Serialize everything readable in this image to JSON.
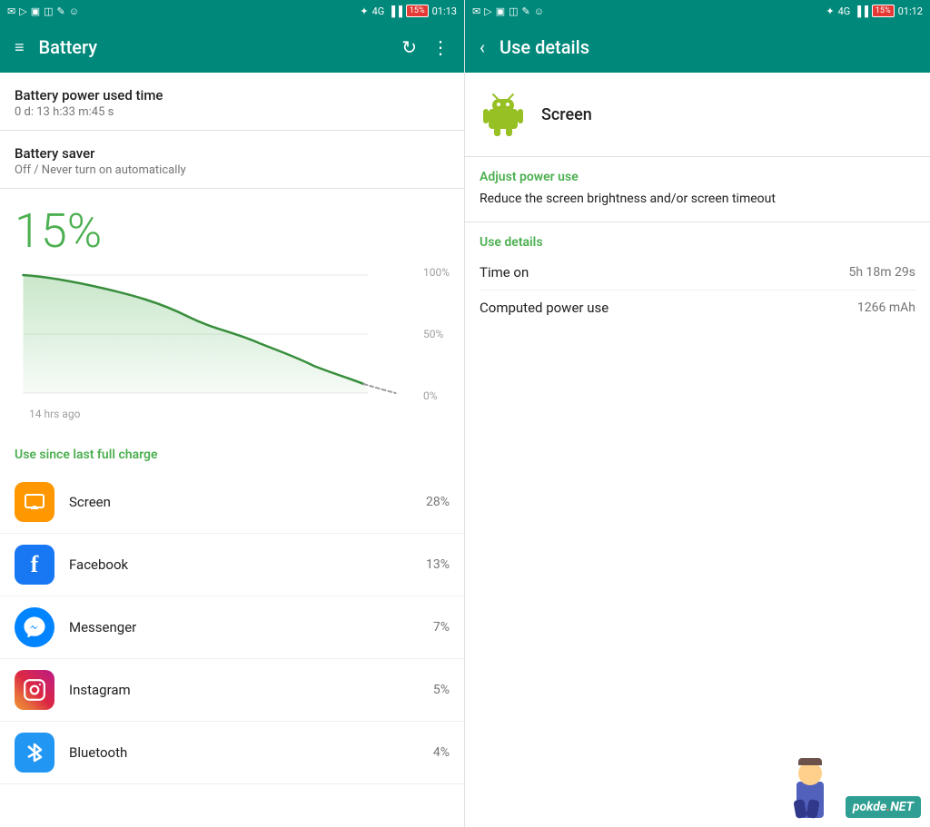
{
  "left": {
    "statusBar": {
      "icons_left": [
        "message",
        "location",
        "camera",
        "wifi",
        "pencil",
        "chat"
      ],
      "bluetooth": "⬡",
      "signal": "4G",
      "battery_label": "15%",
      "time": "01:13"
    },
    "toolbar": {
      "menu_label": "≡",
      "title": "Battery",
      "refresh_label": "↻",
      "more_label": "⋮"
    },
    "battery_power_used": {
      "label": "Battery power used time",
      "value": "0 d: 13 h:33 m:45 s"
    },
    "battery_saver": {
      "label": "Battery saver",
      "value": "Off / Never turn on automatically"
    },
    "percentage": "15%",
    "chart": {
      "time_ago": "14 hrs ago",
      "labels": [
        "100%",
        "50%",
        "0%"
      ]
    },
    "section_title": "Use since last full charge",
    "apps": [
      {
        "name": "Screen",
        "percent": "28%",
        "icon_type": "screen"
      },
      {
        "name": "Facebook",
        "percent": "13%",
        "icon_type": "facebook"
      },
      {
        "name": "Messenger",
        "percent": "7%",
        "icon_type": "messenger"
      },
      {
        "name": "Instagram",
        "percent": "5%",
        "icon_type": "instagram"
      },
      {
        "name": "Bluetooth",
        "percent": "4%",
        "icon_type": "bluetooth"
      }
    ]
  },
  "right": {
    "statusBar": {
      "icons_left": [
        "message",
        "location",
        "camera",
        "wifi",
        "pencil",
        "chat"
      ],
      "bluetooth": "⬡",
      "signal": "4G",
      "battery_label": "15%",
      "time": "01:12"
    },
    "toolbar": {
      "back_label": "‹",
      "title": "Use details"
    },
    "app_name": "Screen",
    "adjust_power_use_title": "Adjust power use",
    "adjust_power_use_text": "Reduce the screen brightness and/or screen timeout",
    "use_details_title": "Use details",
    "rows": [
      {
        "label": "Time on",
        "value": "5h 18m 29s"
      },
      {
        "label": "Computed power use",
        "value": "1266 mAh"
      }
    ]
  }
}
